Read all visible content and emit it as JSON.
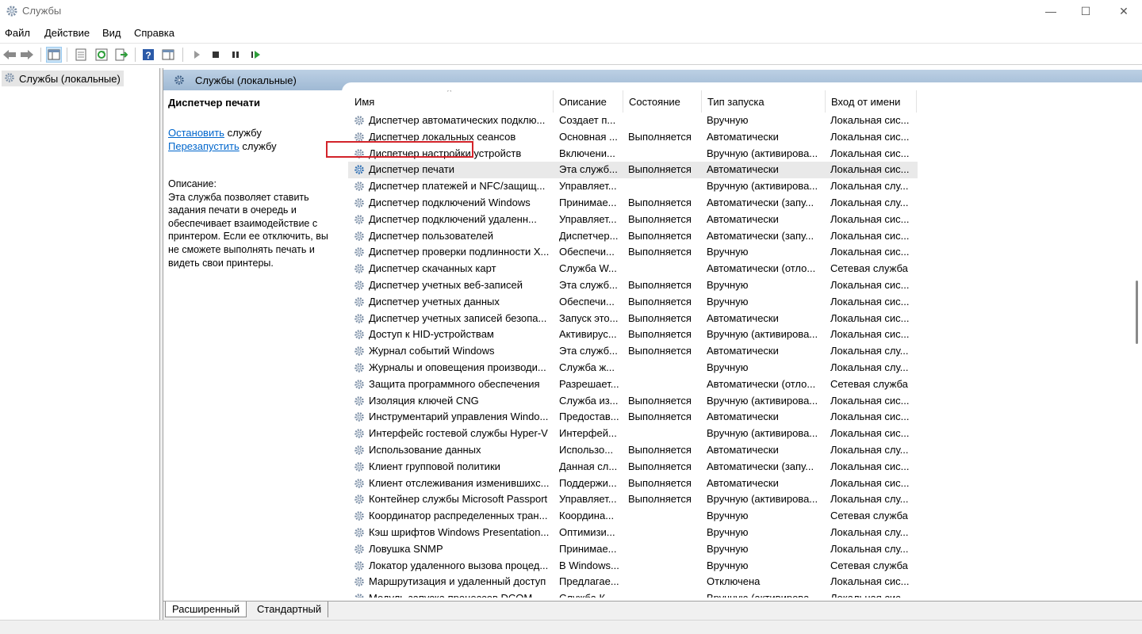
{
  "window": {
    "title": "Службы",
    "minimize_glyph": "—",
    "maximize_glyph": "☐",
    "close_glyph": "✕"
  },
  "menu": [
    "Файл",
    "Действие",
    "Вид",
    "Справка"
  ],
  "toolbar": {
    "icons": [
      "back-icon",
      "forward-icon",
      "show-hide-console-tree-icon",
      "properties-icon",
      "refresh-icon",
      "export-list-icon",
      "help-icon",
      "show-hide-action-pane-icon",
      "start-service-icon",
      "stop-service-icon",
      "pause-service-icon",
      "resume-service-icon"
    ]
  },
  "tree": {
    "root": "Службы (локальные)"
  },
  "panel_header": "Службы (локальные)",
  "extended": {
    "title": "Диспетчер печати",
    "stop_link": "Остановить",
    "stop_suffix": " службу",
    "restart_link": "Перезапустить",
    "restart_suffix": " службу",
    "desc_label": "Описание:",
    "desc_text": "Эта служба позволяет ставить задания печати в очередь и обеспечивает взаимодействие с принтером. Если ее отключить, вы не сможете выполнять печать и видеть свои принтеры."
  },
  "columns": [
    "Имя",
    "Описание",
    "Состояние",
    "Тип запуска",
    "Вход от имени"
  ],
  "sort_indicator": "^",
  "rows": [
    [
      "Диспетчер автоматических подклю...",
      "Создает п...",
      "",
      "Вручную",
      "Локальная сис..."
    ],
    [
      "Диспетчер локальных сеансов",
      "Основная ...",
      "Выполняется",
      "Автоматически",
      "Локальная сис..."
    ],
    [
      "Диспетчер настройки устройств",
      "Включени...",
      "",
      "Вручную (активирова...",
      "Локальная сис..."
    ],
    [
      "Диспетчер печати",
      "Эта служб...",
      "Выполняется",
      "Автоматически",
      "Локальная сис..."
    ],
    [
      "Диспетчер платежей и NFC/защищ...",
      "Управляет...",
      "",
      "Вручную (активирова...",
      "Локальная слу..."
    ],
    [
      "Диспетчер подключений Windows",
      "Принимае...",
      "Выполняется",
      "Автоматически (запу...",
      "Локальная слу..."
    ],
    [
      "Диспетчер подключений удаленн...",
      "Управляет...",
      "Выполняется",
      "Автоматически",
      "Локальная сис..."
    ],
    [
      "Диспетчер пользователей",
      "Диспетчер...",
      "Выполняется",
      "Автоматически (запу...",
      "Локальная сис..."
    ],
    [
      "Диспетчер проверки подлинности X...",
      "Обеспечи...",
      "Выполняется",
      "Вручную",
      "Локальная сис..."
    ],
    [
      "Диспетчер скачанных карт",
      "Служба W...",
      "",
      "Автоматически (отло...",
      "Сетевая служба"
    ],
    [
      "Диспетчер учетных веб-записей",
      "Эта служб...",
      "Выполняется",
      "Вручную",
      "Локальная сис..."
    ],
    [
      "Диспетчер учетных данных",
      "Обеспечи...",
      "Выполняется",
      "Вручную",
      "Локальная сис..."
    ],
    [
      "Диспетчер учетных записей безопа...",
      "Запуск это...",
      "Выполняется",
      "Автоматически",
      "Локальная сис..."
    ],
    [
      "Доступ к HID-устройствам",
      "Активирус...",
      "Выполняется",
      "Вручную (активирова...",
      "Локальная сис..."
    ],
    [
      "Журнал событий Windows",
      "Эта служб...",
      "Выполняется",
      "Автоматически",
      "Локальная слу..."
    ],
    [
      "Журналы и оповещения производи...",
      "Служба ж...",
      "",
      "Вручную",
      "Локальная слу..."
    ],
    [
      "Защита программного обеспечения",
      "Разрешает...",
      "",
      "Автоматически (отло...",
      "Сетевая служба"
    ],
    [
      "Изоляция ключей CNG",
      "Служба из...",
      "Выполняется",
      "Вручную (активирова...",
      "Локальная сис..."
    ],
    [
      "Инструментарий управления Windo...",
      "Предостав...",
      "Выполняется",
      "Автоматически",
      "Локальная сис..."
    ],
    [
      "Интерфейс гостевой службы Hyper-V",
      "Интерфей...",
      "",
      "Вручную (активирова...",
      "Локальная сис..."
    ],
    [
      "Использование данных",
      "Использо...",
      "Выполняется",
      "Автоматически",
      "Локальная слу..."
    ],
    [
      "Клиент групповой политики",
      "Данная сл...",
      "Выполняется",
      "Автоматически (запу...",
      "Локальная сис..."
    ],
    [
      "Клиент отслеживания изменившихс...",
      "Поддержи...",
      "Выполняется",
      "Автоматически",
      "Локальная сис..."
    ],
    [
      "Контейнер службы Microsoft Passport",
      "Управляет...",
      "Выполняется",
      "Вручную (активирова...",
      "Локальная слу..."
    ],
    [
      "Координатор распределенных тран...",
      "Координа...",
      "",
      "Вручную",
      "Сетевая служба"
    ],
    [
      "Кэш шрифтов Windows Presentation...",
      "Оптимизи...",
      "",
      "Вручную",
      "Локальная слу..."
    ],
    [
      "Ловушка SNMP",
      "Принимае...",
      "",
      "Вручную",
      "Локальная слу..."
    ],
    [
      "Локатор удаленного вызова процед...",
      "В Windows...",
      "",
      "Вручную",
      "Сетевая служба"
    ],
    [
      "Маршрутизация и удаленный доступ",
      "Предлагае...",
      "",
      "Отключена",
      "Локальная сис..."
    ],
    [
      "Модуль запуска процессов DCOM...",
      "Служба К...",
      "",
      "Вручную (активирова...",
      "Локальная сис..."
    ]
  ],
  "selected_row": 3,
  "tabs": [
    "Расширенный",
    "Стандартный"
  ],
  "colors": {
    "header_gradient_top": "#bcd0e4",
    "header_gradient_bottom": "#9fb9d4",
    "link": "#0066cc",
    "focus_outline": "#d3232a"
  }
}
